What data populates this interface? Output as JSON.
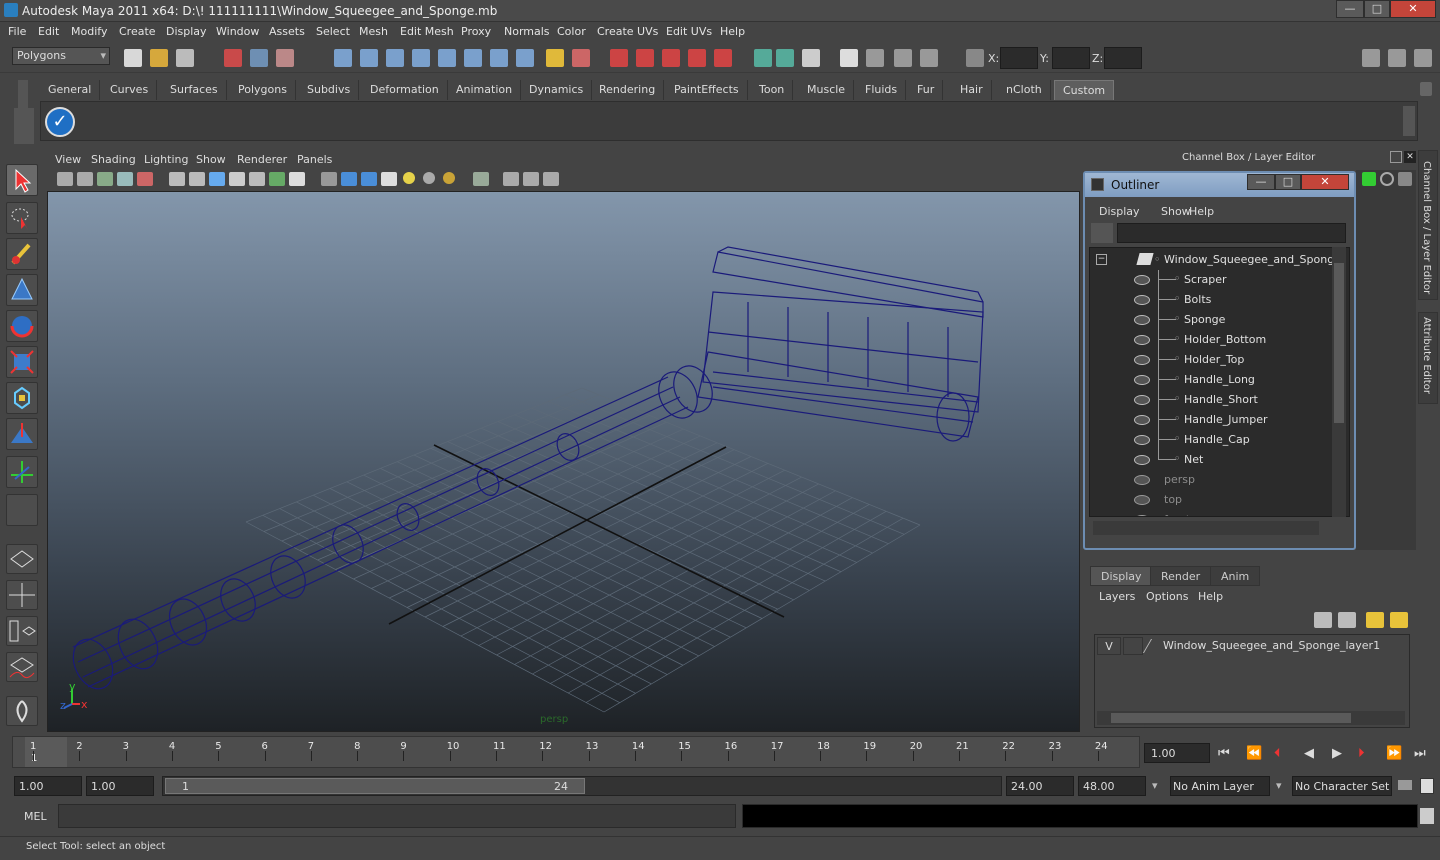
{
  "window": {
    "title": "Autodesk Maya 2011 x64: D:\\! 111111111\\Window_Squeegee_and_Sponge.mb",
    "min": "—",
    "max": "□",
    "close": "✕"
  },
  "menubar": [
    "File",
    "Edit",
    "Modify",
    "Create",
    "Display",
    "Window",
    "Assets",
    "Select",
    "Mesh",
    "Edit Mesh",
    "Proxy",
    "Normals",
    "Color",
    "Create UVs",
    "Edit UVs",
    "Help"
  ],
  "statusline": {
    "mode": "Polygons",
    "x_label": "X:",
    "y_label": "Y:",
    "z_label": "Z:"
  },
  "shelf_tabs": [
    "General",
    "Curves",
    "Surfaces",
    "Polygons",
    "Subdivs",
    "Deformation",
    "Animation",
    "Dynamics",
    "Rendering",
    "PaintEffects",
    "Toon",
    "Muscle",
    "Fluids",
    "Fur",
    "Hair",
    "nCloth",
    "Custom"
  ],
  "shelf_active": "Custom",
  "viewport": {
    "menus": [
      "View",
      "Shading",
      "Lighting",
      "Show",
      "Renderer",
      "Panels"
    ],
    "camera_label": "persp",
    "axis_x": "x",
    "axis_y": "y",
    "axis_z": "z"
  },
  "channel_box": {
    "header": "Channel Box / Layer Editor"
  },
  "side_tabs": [
    "Channel Box / Layer Editor",
    "Attribute Editor"
  ],
  "outliner": {
    "title": "Outliner",
    "menus": [
      "Display",
      "Show",
      "Help"
    ],
    "root": "Window_Squeegee_and_Sponge",
    "children": [
      "Scraper",
      "Bolts",
      "Sponge",
      "Holder_Bottom",
      "Holder_Top",
      "Handle_Long",
      "Handle_Short",
      "Handle_Jumper",
      "Handle_Cap",
      "Net"
    ],
    "cameras": [
      "persp",
      "top",
      "front"
    ]
  },
  "layer_editor": {
    "tabs": [
      "Display",
      "Render",
      "Anim"
    ],
    "active_tab": "Display",
    "menus": [
      "Layers",
      "Options",
      "Help"
    ],
    "layer": {
      "visible": "V",
      "name": "Window_Squeegee_and_Sponge_layer1"
    }
  },
  "timeline": {
    "ticks": [
      "1",
      "2",
      "3",
      "4",
      "5",
      "6",
      "7",
      "8",
      "9",
      "10",
      "11",
      "12",
      "13",
      "14",
      "15",
      "16",
      "17",
      "18",
      "19",
      "20",
      "21",
      "22",
      "23",
      "24"
    ],
    "current_frame": "1",
    "current_time_field": "1.00"
  },
  "range": {
    "start": "1.00",
    "start_inner": "1.00",
    "slider_min": "1",
    "slider_max": "24",
    "end_inner": "24.00",
    "end": "48.00",
    "anim_layer": "No Anim Layer",
    "character_set": "No Character Set"
  },
  "command": {
    "label": "MEL"
  },
  "help": {
    "text": "Select Tool: select an object"
  },
  "colors": {
    "wireframe": "#1a1a7a",
    "outliner_border": "#6d8db2",
    "viewport_top": "#8396ab",
    "viewport_bottom": "#1e2226"
  }
}
